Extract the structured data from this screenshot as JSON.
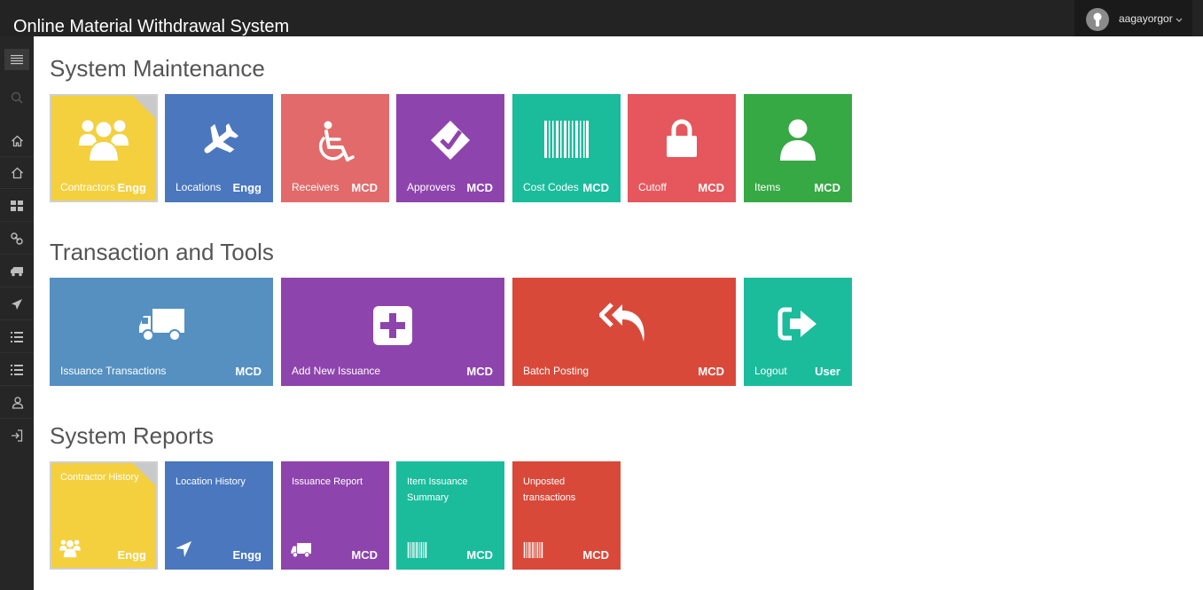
{
  "header": {
    "app_title": "Online Material Withdrawal System",
    "username": "aagayorgor"
  },
  "sidebar": {
    "items": [
      {
        "icon": "menu-icon"
      },
      {
        "icon": "search-icon"
      },
      {
        "icon": "home-icon"
      },
      {
        "icon": "home-outline-icon"
      },
      {
        "icon": "grid-icon"
      },
      {
        "icon": "link-icon"
      },
      {
        "icon": "truck-icon"
      },
      {
        "icon": "send-icon"
      },
      {
        "icon": "list-icon"
      },
      {
        "icon": "list-icon"
      },
      {
        "icon": "users-icon"
      },
      {
        "icon": "logout-icon"
      }
    ]
  },
  "sections": {
    "maintenance": {
      "title": "System Maintenance",
      "tiles": [
        {
          "label": "Contractors",
          "badge": "Engg",
          "color": "#f4d03f",
          "icon": "group-icon"
        },
        {
          "label": "Locations",
          "badge": "Engg",
          "color": "#4a77be",
          "icon": "plane-icon"
        },
        {
          "label": "Receivers",
          "badge": "MCD",
          "color": "#e26a6a",
          "icon": "wheelchair-icon"
        },
        {
          "label": "Approvers",
          "badge": "MCD",
          "color": "#8e44ad",
          "icon": "check-diamond-icon"
        },
        {
          "label": "Cost Codes",
          "badge": "MCD",
          "color": "#1abc9c",
          "icon": "barcode-icon"
        },
        {
          "label": "Cutoff",
          "badge": "MCD",
          "color": "#e5575c",
          "icon": "lock-icon"
        },
        {
          "label": "Items",
          "badge": "MCD",
          "color": "#36a844",
          "icon": "user-icon"
        }
      ]
    },
    "transactions": {
      "title": "Transaction and Tools",
      "tiles": [
        {
          "label": "Issuance Transactions",
          "badge": "MCD",
          "color": "#5590c1",
          "icon": "truck-icon"
        },
        {
          "label": "Add New Issuance",
          "badge": "MCD",
          "color": "#8e44ad",
          "icon": "plus-square-icon"
        },
        {
          "label": "Batch Posting",
          "badge": "MCD",
          "color": "#d9493a",
          "icon": "reply-all-icon"
        },
        {
          "label": "Logout",
          "badge": "User",
          "color": "#1abc9c",
          "icon": "sign-out-icon"
        }
      ]
    },
    "reports": {
      "title": "System Reports",
      "tiles": [
        {
          "label": "Contractor History",
          "badge": "Engg",
          "color": "#f4d03f",
          "icon": "group-icon"
        },
        {
          "label": "Location History",
          "badge": "Engg",
          "color": "#4a77be",
          "icon": "location-arrow-icon"
        },
        {
          "label": "Issuance Report",
          "badge": "MCD",
          "color": "#8e44ad",
          "icon": "truck-icon"
        },
        {
          "label": "Item Issuance Summary",
          "badge": "MCD",
          "color": "#1abc9c",
          "icon": "barcode-icon"
        },
        {
          "label": "Unposted transactions",
          "badge": "MCD",
          "color": "#d9493a",
          "icon": "barcode-icon"
        }
      ]
    }
  }
}
